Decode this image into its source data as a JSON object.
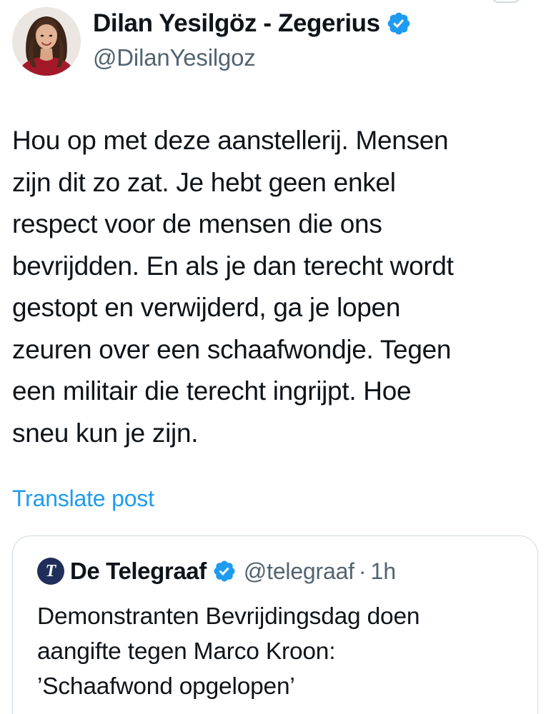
{
  "author": {
    "display_name": "Dilan Yesilgöz - Zegerius",
    "handle": "@DilanYesilgoz",
    "avatar_icon": "profile-photo",
    "verified_icon": "verified-badge-icon"
  },
  "post": {
    "lines": [
      "Hou op met deze aanstellerij. Mensen",
      "zijn dit zo zat. Je hebt geen enkel",
      "respect voor de mensen die ons",
      "bevrijdden. En als je dan terecht wordt",
      "gestopt en verwijderd, ga je lopen",
      "zeuren over een schaafwondje. Tegen",
      "een militair die terecht ingrijpt. Hoe",
      "sneu kun je zijn."
    ],
    "translate_label": "Translate post"
  },
  "quote": {
    "logo_letter": "T",
    "display_name": "De Telegraaf",
    "handle": "@telegraaf",
    "separator": "·",
    "time": "1h",
    "lines": [
      "Demonstranten Bevrijdingsdag doen",
      "aangifte tegen Marco Kroon:",
      "’Schaafwond opgelopen’"
    ]
  },
  "colors": {
    "text": "#0f1419",
    "secondary": "#536471",
    "link": "#1d9bf0",
    "verified": "#1d9bf0",
    "border": "#cfd9de",
    "telegraaf_logo": "#1f2f5a"
  }
}
